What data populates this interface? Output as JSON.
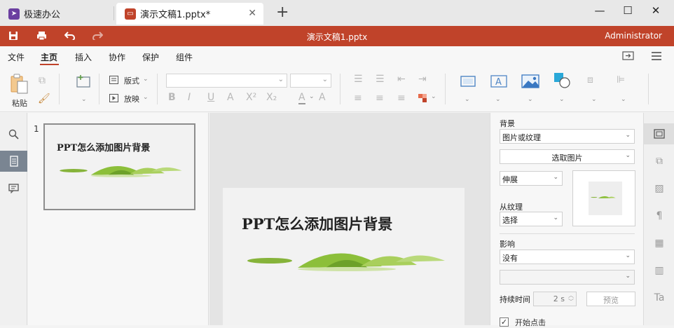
{
  "tabs": [
    {
      "label": "极速办公",
      "icon": "rocket-icon",
      "color": "#6b3fa0"
    },
    {
      "label": "演示文稿1.pptx*",
      "icon": "presentation-icon",
      "color": "#c0432a"
    }
  ],
  "titlebar": {
    "doc_title": "演示文稿1.pptx",
    "user": "Administrator",
    "accent": "#c0432a"
  },
  "menu": [
    "文件",
    "主页",
    "插入",
    "协作",
    "保护",
    "组件"
  ],
  "toolbar": {
    "paste": "粘贴",
    "layout": "版式",
    "slideshow": "放映",
    "format_buttons": [
      "B",
      "I",
      "U",
      "A",
      "X²",
      "X₂"
    ]
  },
  "slides": {
    "number": "1",
    "title": "PPT怎么添加图片背景"
  },
  "props": {
    "background_label": "背景",
    "fill_type": "图片或纹理",
    "select_image": "选取图片",
    "stretch": "伸展",
    "from_texture_label": "从纹理",
    "texture_select": "选择",
    "effect_label": "影响",
    "effect_value": "没有",
    "duration_label": "持续时间",
    "duration_value": "2 s",
    "preview": "预览",
    "start_on_click": "开始点击"
  }
}
